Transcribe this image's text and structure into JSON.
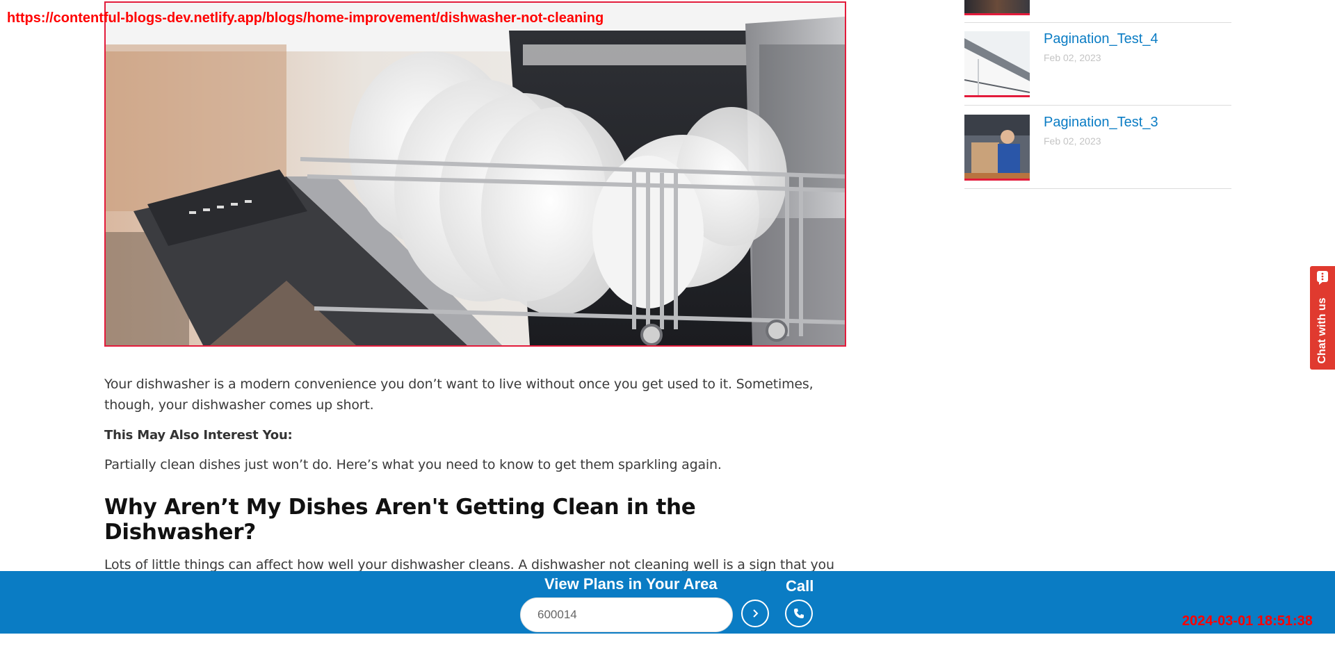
{
  "overlay": {
    "url": "https://contentful-blogs-dev.netlify.app/blogs/home-improvement/dishwasher-not-cleaning",
    "timestamp": "2024-03-01 18:51:38"
  },
  "hero": {
    "image_subject": "open dishwasher with clean white plates and bowls",
    "border_color": "#e31b3b"
  },
  "article": {
    "intro": "Your dishwasher is a modern convenience you don’t want to live without once you get used to it. Sometimes, though, your dishwasher comes up short.",
    "interest_label": "This May Also Interest You:",
    "lead": "Partially clean dishes just won’t do. Here’s what you need to know to get them sparkling again.",
    "heading": "Why Aren’t My Dishes Aren't Getting Clean in the Dishwasher?",
    "body": "Lots of little things can affect how well your dishwasher cleans. A dishwasher not cleaning well is a sign that you need to do a little troubleshooting and maintenance. Here are some common causes of dirty dishes in the dishwasher."
  },
  "sidebar": {
    "items": [
      {
        "title": "Pagination_Test_4",
        "date": "Feb 02, 2023",
        "thumb_icon": "house-roof-icon"
      },
      {
        "title": "Pagination_Test_3",
        "date": "Feb 02, 2023",
        "thumb_icon": "technician-photo-icon"
      }
    ]
  },
  "chat": {
    "label": "Chat with us",
    "icon": "chat-bubble-icon"
  },
  "bottom_bar": {
    "heading": "View Plans in Your Area",
    "zip_value": "600014",
    "go_icon": "chevron-right-icon",
    "call_label": "Call",
    "call_icon": "phone-icon"
  },
  "colors": {
    "brand_blue": "#0a7cc4",
    "accent_red": "#e31b3b",
    "chat_red": "#e03a2f",
    "date_gray": "#c4c4c4"
  }
}
